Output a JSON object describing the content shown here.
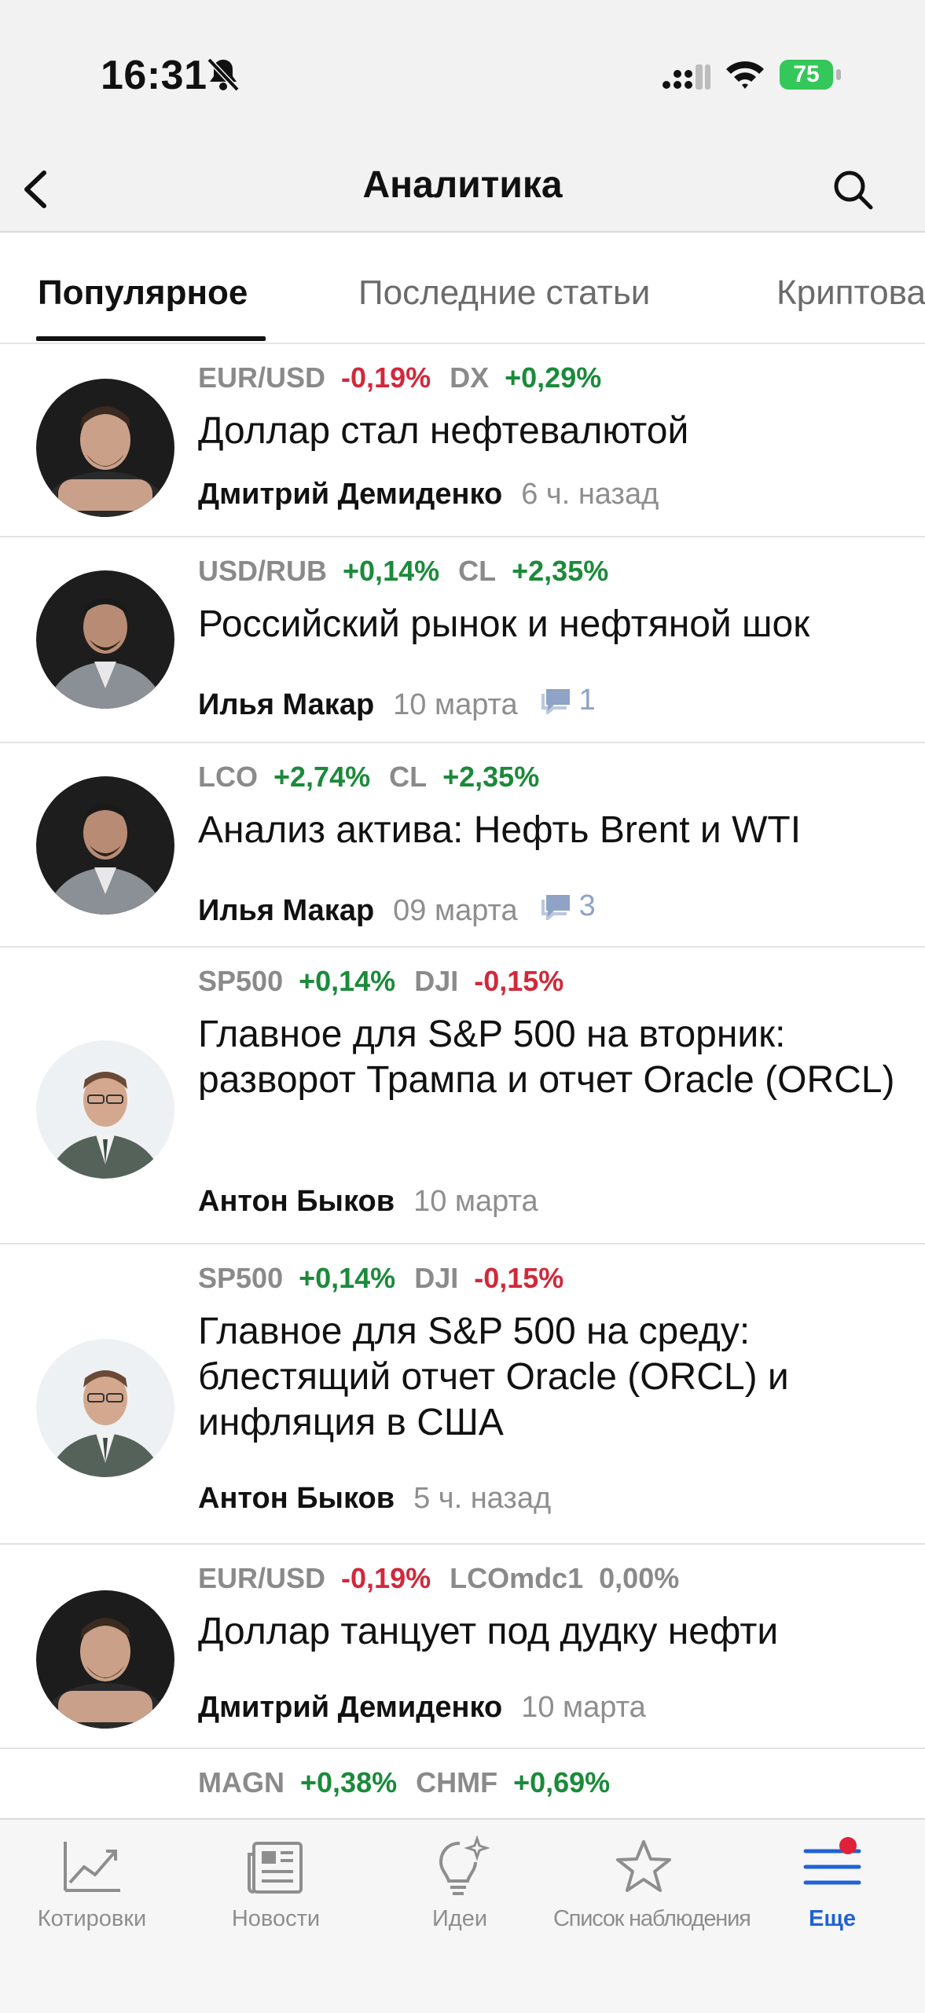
{
  "status": {
    "time": "16:31",
    "battery": "75"
  },
  "nav": {
    "title": "Аналитика"
  },
  "tabs": [
    {
      "label": "Популярное"
    },
    {
      "label": "Последние статьи"
    },
    {
      "label": "Криптовалюты"
    }
  ],
  "articles": [
    {
      "tickers": [
        {
          "symbol": "EUR/USD",
          "change": "-0,19%"
        },
        {
          "symbol": "DX",
          "change": "+0,29%"
        }
      ],
      "title": "Доллар стал нефтевалютой",
      "author": "Дмитрий Демиденко",
      "date": "6 ч. назад",
      "comments": ""
    },
    {
      "tickers": [
        {
          "symbol": "USD/RUB",
          "change": "+0,14%"
        },
        {
          "symbol": "CL",
          "change": "+2,35%"
        }
      ],
      "title": "Российский рынок и нефтяной шок",
      "author": "Илья Макар",
      "date": "10 марта",
      "comments": "1"
    },
    {
      "tickers": [
        {
          "symbol": "LCO",
          "change": "+2,74%"
        },
        {
          "symbol": "CL",
          "change": "+2,35%"
        }
      ],
      "title": "Анализ актива: Нефть Brent и WTI",
      "author": "Илья Макар",
      "date": "09 марта",
      "comments": "3"
    },
    {
      "tickers": [
        {
          "symbol": "SP500",
          "change": "+0,14%"
        },
        {
          "symbol": "DJI",
          "change": "-0,15%"
        }
      ],
      "title": "Главное для S&P 500 на вторник: разворот Трампа и отчет Oracle (ORCL)",
      "author": "Антон Быков",
      "date": "10 марта",
      "comments": ""
    },
    {
      "tickers": [
        {
          "symbol": "SP500",
          "change": "+0,14%"
        },
        {
          "symbol": "DJI",
          "change": "-0,15%"
        }
      ],
      "title": "Главное для S&P 500 на среду: блестящий отчет Oracle (ORCL) и инфляция в США",
      "author": "Антон Быков",
      "date": "5 ч. назад",
      "comments": ""
    },
    {
      "tickers": [
        {
          "symbol": "EUR/USD",
          "change": "-0,19%"
        },
        {
          "symbol": "LCOmdc1",
          "change": "0,00%"
        }
      ],
      "title": "Доллар танцует под дудку нефти",
      "author": "Дмитрий Демиденко",
      "date": "10 марта",
      "comments": ""
    },
    {
      "tickers": [
        {
          "symbol": "MAGN",
          "change": "+0,38%"
        },
        {
          "symbol": "CHMF",
          "change": "+0,69%"
        }
      ],
      "title": "",
      "author": "",
      "date": "",
      "comments": ""
    }
  ],
  "tabbar": [
    {
      "label": "Котировки",
      "icon": "chart-trend-icon"
    },
    {
      "label": "Новости",
      "icon": "newspaper-icon"
    },
    {
      "label": "Идеи",
      "icon": "lightbulb-icon"
    },
    {
      "label": "Список наблюдения",
      "icon": "star-icon"
    },
    {
      "label": "Еще",
      "icon": "menu-icon"
    }
  ],
  "colors": {
    "positive": "#1b8a3a",
    "negative": "#d0293b",
    "accent": "#1f62d6",
    "badge": "#e0213a"
  }
}
